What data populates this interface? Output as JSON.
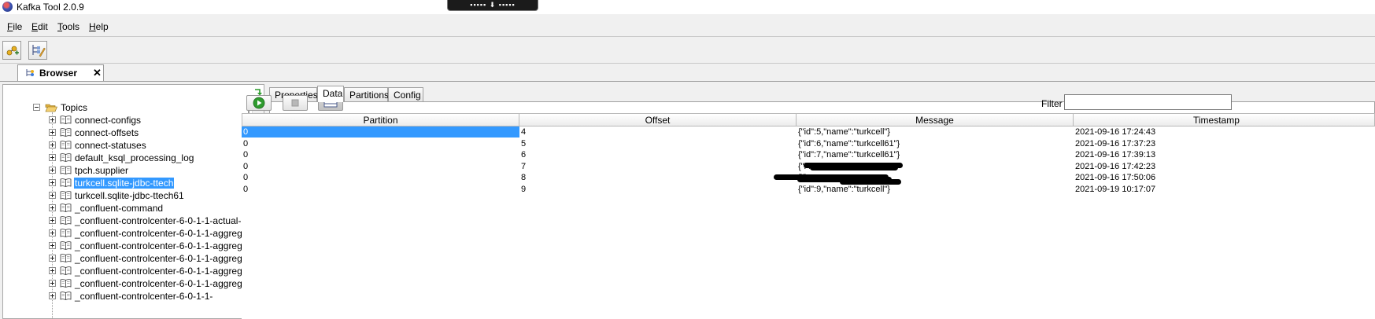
{
  "window": {
    "title": "Kafka Tool  2.0.9"
  },
  "menu": {
    "items": [
      {
        "label": "File",
        "key": "F",
        "rest": "ile"
      },
      {
        "label": "Edit",
        "key": "E",
        "rest": "dit"
      },
      {
        "label": "Tools",
        "key": "T",
        "rest": "ools"
      },
      {
        "label": "Help",
        "key": "H",
        "rest": "elp"
      }
    ]
  },
  "browser_tab": {
    "label": "Browser",
    "close": "✕"
  },
  "tree": {
    "root": {
      "label": "Topics"
    },
    "items": [
      {
        "label": "connect-configs"
      },
      {
        "label": "connect-offsets"
      },
      {
        "label": "connect-statuses"
      },
      {
        "label": "default_ksql_processing_log"
      },
      {
        "label": "tpch.supplier"
      },
      {
        "label": "turkcell.sqlite-jdbc-ttech"
      },
      {
        "label": "turkcell.sqlite-jdbc-ttech61"
      },
      {
        "label": "_confluent-command"
      },
      {
        "label": "_confluent-controlcenter-6-0-1-1-actual-"
      },
      {
        "label": "_confluent-controlcenter-6-0-1-1-aggreg"
      },
      {
        "label": "_confluent-controlcenter-6-0-1-1-aggreg"
      },
      {
        "label": "_confluent-controlcenter-6-0-1-1-aggreg"
      },
      {
        "label": "_confluent-controlcenter-6-0-1-1-aggreg"
      },
      {
        "label": "_confluent-controlcenter-6-0-1-1-aggreg"
      },
      {
        "label": "_confluent-controlcenter-6-0-1-1-"
      }
    ],
    "selected_index": 5
  },
  "sub_tabs": [
    {
      "label": "Properties"
    },
    {
      "label": "Data"
    },
    {
      "label": "Partitions"
    },
    {
      "label": "Config"
    }
  ],
  "active_sub_tab": 1,
  "filter": {
    "label": "Filter",
    "value": ""
  },
  "table": {
    "columns": [
      "Partition",
      "Offset",
      "Message",
      "Timestamp"
    ],
    "rows": [
      {
        "partition": "0",
        "offset": "4",
        "message": "{\"id\":5,\"name\":\"turkcell\"}",
        "timestamp": "2021-09-16 17:24:43"
      },
      {
        "partition": "0",
        "offset": "5",
        "message": "{\"id\":6,\"name\":\"turkcell61\"}",
        "timestamp": "2021-09-16 17:37:23"
      },
      {
        "partition": "0",
        "offset": "6",
        "message": "{\"id\":7,\"name\":\"turkcell61\"}",
        "timestamp": "2021-09-16 17:39:13"
      },
      {
        "partition": "0",
        "offset": "7",
        "message": "{\"i    name\"",
        "timestamp": "2021-09-16 17:42:23"
      },
      {
        "partition": "0",
        "offset": "8",
        "message": "{\"i",
        "timestamp": "2021-09-16 17:50:06"
      },
      {
        "partition": "0",
        "offset": "9",
        "message": "{\"id\":9,\"name\":\"turkcell\"}",
        "timestamp": "2021-09-19 10:17:07"
      }
    ]
  },
  "colors": {
    "selection": "#3399ff",
    "play": "#2e9b2e"
  }
}
